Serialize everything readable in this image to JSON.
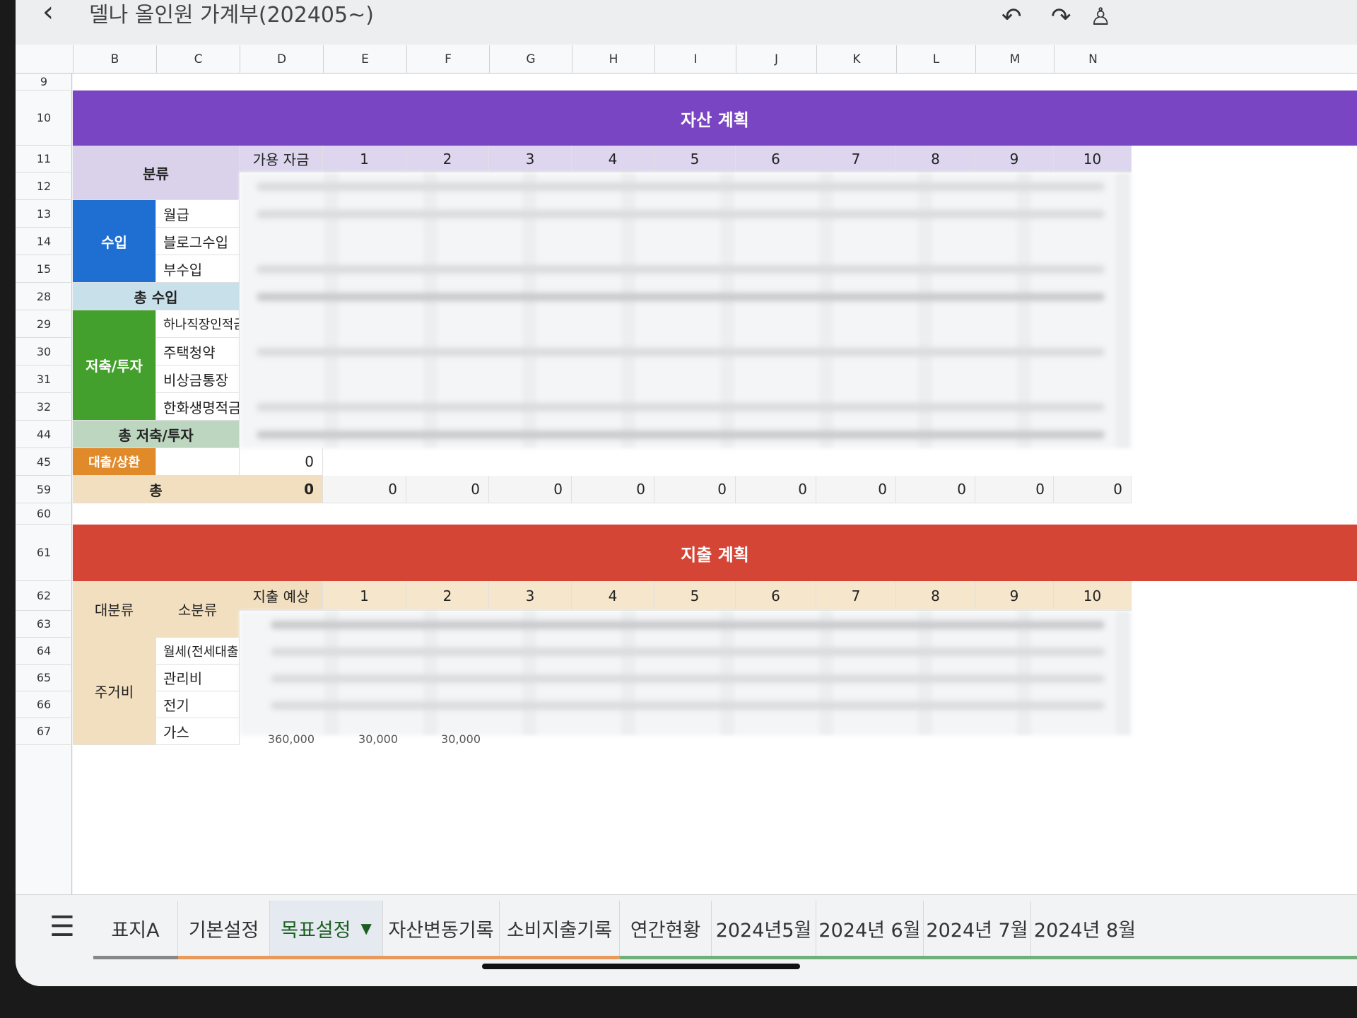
{
  "app": {
    "title": "델나 올인원 가계부(202405~)",
    "back_icon": "back-arrow-icon",
    "toolbar_icons": [
      "undo-icon",
      "redo-icon",
      "user-icon"
    ]
  },
  "columns": [
    "B",
    "C",
    "D",
    "E",
    "F",
    "G",
    "H",
    "I",
    "J",
    "K",
    "L",
    "M",
    "N"
  ],
  "rows": [
    "9",
    "10",
    "11",
    "12",
    "13",
    "14",
    "15",
    "28",
    "29",
    "30",
    "31",
    "32",
    "44",
    "45",
    "59",
    "60",
    "61",
    "62",
    "63",
    "64",
    "65",
    "66",
    "67"
  ],
  "asset_plan": {
    "title": "자산 계획",
    "category_header": "분류",
    "available_header": "가용 자금",
    "months": [
      "1",
      "2",
      "3",
      "4",
      "5",
      "6",
      "7",
      "8",
      "9",
      "10"
    ],
    "income_group": "수입",
    "income_items": [
      "월급",
      "블로그수입",
      "부수입"
    ],
    "total_income": "총 수입",
    "savings_group": "저축/투자",
    "savings_items": [
      "하나직장인적금",
      "주택청약",
      "비상금통장",
      "한화생명적금"
    ],
    "total_savings": "총 저축/투자",
    "loan_label": "대출/상환",
    "loan_value": "0",
    "total_label": "총",
    "total_available": "0",
    "total_values": [
      "0",
      "0",
      "0",
      "0",
      "0",
      "0",
      "0",
      "0",
      "0",
      "0"
    ]
  },
  "expense_plan": {
    "title": "지출 계획",
    "major_header": "대분류",
    "minor_header": "소분류",
    "expected_header": "지출 예상",
    "months": [
      "1",
      "2",
      "3",
      "4",
      "5",
      "6",
      "7",
      "8",
      "9",
      "10"
    ],
    "housing_group": "주거비",
    "housing_items": [
      "월세(전세대출이",
      "관리비",
      "전기",
      "가스"
    ],
    "partial_values": [
      "360,000",
      "30,000",
      "30,000"
    ]
  },
  "colors": {
    "asset_band": "#7a45c2",
    "expense_band": "#d44535",
    "income": "#1e6fd1",
    "savings": "#43a02c",
    "loan": "#e08a2a",
    "total_income_bg": "#c7e0ea",
    "total_savings_bg": "#bcd6bf"
  },
  "tabs": {
    "menu_icon": "hamburger-menu-icon",
    "items": [
      "표지A",
      "기본설정",
      "목표설정",
      "자산변동기록",
      "소비지출기록",
      "연간현황",
      "2024년5월",
      "2024년 6월",
      "2024년 7월",
      "2024년 8월"
    ],
    "active": "목표설정",
    "dropdown_icon": "caret-down-icon"
  }
}
